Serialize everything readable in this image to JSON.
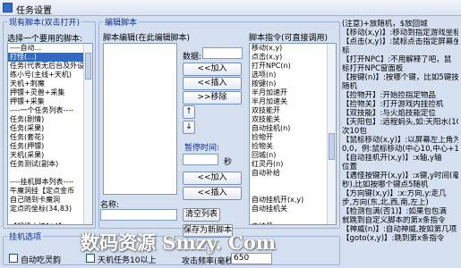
{
  "window": {
    "title": "任务设置"
  },
  "left_group": {
    "title": "现有脚本(双击打开)",
    "prompt": "选择一个要用的脚本:",
    "items": [
      "----自动...",
      "打怪(...)",
      "任务(代表无后台及外设...)",
      "练小号(主线+天机)",
      "天机+刺魔",
      "押镖+灵兽+采集",
      "押镖+采集",
      "----一个任务列表----",
      "任务(剧情)",
      "任务(采果)",
      "任务(套花)",
      "任务(押镖)",
      "天机(采果)",
      "任务测试(副本)",
      "",
      "----挂机脚本列表----",
      "牛魔洞挂【定点金币",
      "自己随到卡魔洞",
      "定点的坐标(34,83)",
      "",
      "【超级火墙1*4】",
      "【超级火墙5*5】"
    ],
    "selected_index": 1
  },
  "middle_group": {
    "title": "编辑脚本",
    "edit_label": "脚本编辑(在此编辑脚本)",
    "data_label": "数据:",
    "add_button": "<<加入",
    "insert_button": "<<插入",
    "remove_button": ">>移除",
    "up_arrow": "↑",
    "down_arrow": "↓",
    "pause_label": "暂停时间:",
    "seconds_label": "秒",
    "add_button2": "<<加入",
    "insert_button2": "<<插入",
    "clear_button": "清空列表",
    "name_label": "名称:",
    "save_button": "保存为新脚本"
  },
  "commands_group": {
    "title": "脚本指令(可直接调用)",
    "items": [
      "移动(x,y)",
      "点击(x,y)",
      "打开NPC(n)",
      "选项(n)",
      "按键(n)",
      "半月加速开",
      "半月加速关",
      "双技能开",
      "双技能关",
      "自动挂机(n)",
      "捡物开",
      "捡物关",
      "回城(n)",
      "红灵丹(n)",
      "自动补给",
      "",
      "",
      "自动挂机开(x,y)",
      "自动挂机关",
      "",
      "内挂开",
      "----",
      "暂停(n)"
    ]
  },
  "notes": {
    "lines": [
      "(注意)+放随机，$放回城",
      "",
      "【移动(x,y)】:移动到指定游戏坐标",
      "【点击(x,y)】:鼠标点击指定屏幕坐",
      "标",
      "【打开NPC】:不用解释了吧，鼠",
      "标打开NPC窗面板",
      "【按键(n)】:按哪个键，比如5键技",
      "随机",
      "【捡物开】:开始捡指定物品",
      "【捡物关】:打开游戏内挂捡机",
      "【双技能】:与火焰技能定位",
      "【天阳包】:远程蚂头,如:天阳水(10)",
      "次10包",
      "【鼠标移动(x,y)】:以屏幕左上角为",
      "0,0，例:鼠标移动(中心10,中心+10)",
      "【自动挂机开(x,y)】:x轴,y轴",
      "位置",
      "【遇怪按键开(x,y)】:x键,y时间(毫",
      "秒),比如按哪个键点5随机",
      "【方向键(x,y)】:x:方向,y:走几",
      "步,方向(东,北,西,南,左上)",
      "【检测包满(否1)】:如果包包满",
      "就跳到自定义脚本的第x条指令",
      "【神威(n)】:自动神威,按如第几项",
      "",
      "【goto(x,y)】:跳到第x条指令",
      "指令，请用2次",
      "【检测任务完成】:表示在执行任务",
      "时，若检测未完成任务,以便回复",
      "跳到第几条"
    ]
  },
  "hang_group": {
    "title": "挂机选项",
    "auto_eat": "自动吃灵韵",
    "tianji": "天机任务10以上",
    "attack_freq_label": "攻击频率(毫秒):",
    "attack_freq_value": "650"
  },
  "watermark": {
    "text": "数码资源 Smzy. Com"
  }
}
